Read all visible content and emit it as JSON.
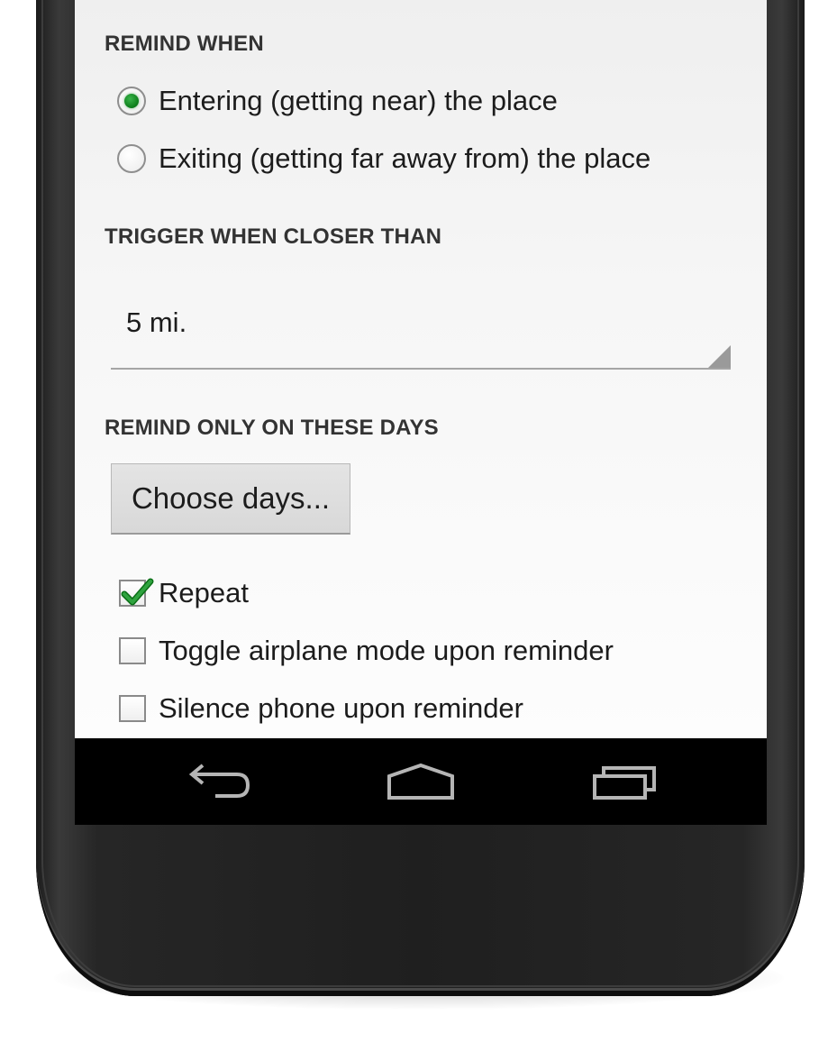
{
  "remind_when": {
    "header": "REMIND WHEN",
    "options": [
      {
        "label": "Entering (getting near) the place",
        "selected": true
      },
      {
        "label": "Exiting (getting far away from) the place",
        "selected": false
      }
    ]
  },
  "trigger": {
    "header": "TRIGGER WHEN CLOSER THAN",
    "value": "5 mi."
  },
  "days": {
    "header": "REMIND ONLY ON THESE DAYS",
    "button_label": "Choose days..."
  },
  "options": [
    {
      "label": "Repeat",
      "checked": true
    },
    {
      "label": "Toggle airplane mode upon reminder",
      "checked": false
    },
    {
      "label": "Silence phone upon reminder",
      "checked": false
    }
  ],
  "navigation": {
    "back_icon": "back-icon",
    "home_icon": "home-icon",
    "recents_icon": "recent-apps-icon"
  },
  "colors": {
    "accent_green": "#0b7c19",
    "screen_background": "#f6f6f6",
    "navbar_background": "#000000",
    "device_body": "#262626"
  }
}
